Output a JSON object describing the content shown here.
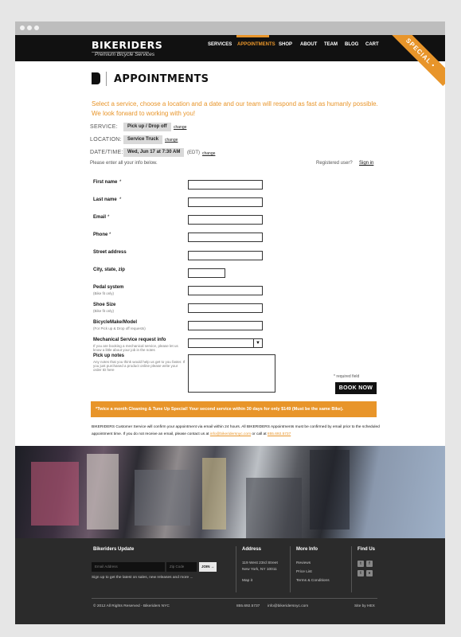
{
  "header": {
    "logo": "BIKERIDERS",
    "tagline": "Premium Bicycle Services",
    "nav": [
      "SERVICES",
      "APPOINTMENTS",
      "SHOP",
      "ABOUT",
      "TEAM",
      "BLOG",
      "CART"
    ],
    "active_nav": "APPOINTMENTS",
    "special_badge": "SPECIAL •"
  },
  "page": {
    "title": "APPOINTMENTS",
    "intro": "Select a service, choose a location and a date and our team will respond as fast as humanly possible. We look forward to working with you!",
    "service_label": "SERVICE:",
    "service_value": "Pick up / Drop off",
    "location_label": "LOCATION:",
    "location_value": "Service Truck",
    "datetime_label": "DATE/TIME:",
    "datetime_value": "Wed, Jun 17 at 7:30 AM",
    "timezone": "(EDT)",
    "change": "change",
    "enter_info": "Please enter all your info below.",
    "registered": "Registered user?",
    "signin": "Sign in"
  },
  "form": {
    "fields": [
      {
        "label": "First name",
        "required": "*",
        "sub": ""
      },
      {
        "label": "Last name",
        "required": "*",
        "sub": ""
      },
      {
        "label": "Email",
        "required": "*",
        "sub": ""
      },
      {
        "label": "Phone",
        "required": "*",
        "sub": ""
      },
      {
        "label": "Street address",
        "required": "",
        "sub": ""
      },
      {
        "label": "City, state, zip",
        "required": "",
        "sub": ""
      },
      {
        "label": "Pedal system",
        "required": "",
        "sub": "(Bike fit only)"
      },
      {
        "label": "Shoe Size",
        "required": "",
        "sub": "(Bike fit only)"
      },
      {
        "label": "BicycleMake/Model",
        "required": "",
        "sub": "(For Pick up & Drop off requests)"
      },
      {
        "label": "Mechanical Service request info",
        "required": "",
        "sub": "If you are booking a mechanical service, please let us know a little about your job in the notes"
      },
      {
        "label": "Pick up notes",
        "required": "",
        "sub": "Any notes that you think would help us get to you faster. If you just purchased a product online please write your order ID here"
      }
    ],
    "required_note": "* required field",
    "submit": "BOOK NOW"
  },
  "promo": "*Twice a month Cleaning & Tune Up Special! Your second service within 30 days for only $149 (Must be the same Bike).",
  "confirm": {
    "text": "BIKERIDERS Customer Service will confirm your appointment via email within 24 hours. All BIKERIDERS Appointments must be confirmed by email prior to the scheduled appointment time. If you do not receive an email, please contact us at",
    "email": "info@bikeridersnyc.com",
    "or_call": "or call at",
    "phone": "855.692.5737"
  },
  "footer": {
    "update_title": "Bikeriders Update",
    "email_placeholder": "Email Address",
    "zip_placeholder": "Zip Code",
    "join": "JOIN →",
    "signup_text": "Sign up to get the latest on sales, new releases and more ...",
    "address_title": "Address",
    "address_line1": "119 West 23rd Street",
    "address_line2": "New York, NY 10011",
    "map_it": "Map it",
    "more_info_title": "More Info",
    "more_info": [
      "Reviews",
      "Price List",
      "Terms & Conditions"
    ],
    "find_us_title": "Find Us",
    "copyright": "© 2012 All Rights Reserved - Bikeriders NYC",
    "phone": "855.692.5737",
    "email": "info@bikeridersnyc.com",
    "site_by": "Site by HEX"
  },
  "colors": {
    "accent": "#e8952a",
    "dark": "#111111",
    "footer": "#2b2b2b"
  }
}
